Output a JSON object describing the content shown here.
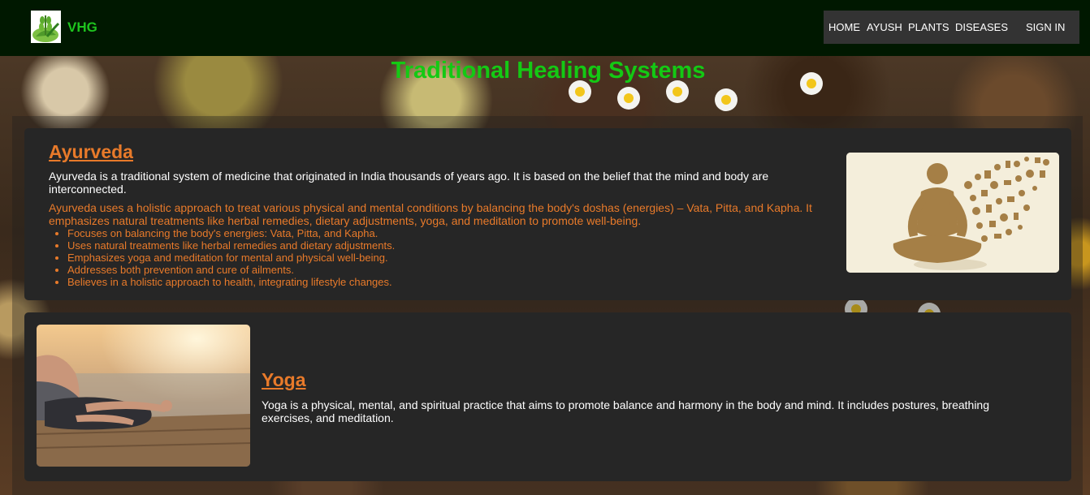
{
  "header": {
    "brand": "VHG",
    "nav": {
      "home": "HOME",
      "ayush": "AYUSH",
      "plants": "PLANTS",
      "diseases": "DISEASES",
      "sign_in": "SIGN IN"
    }
  },
  "page": {
    "title": "Traditional Healing Systems"
  },
  "ayurveda": {
    "title": "Ayurveda",
    "intro": "Ayurveda is a traditional system of medicine that originated in India thousands of years ago. It is based on the belief that the mind and body are interconnected.",
    "detail": "Ayurveda uses a holistic approach to treat various physical and mental conditions by balancing the body's doshas (energies) – Vata, Pitta, and Kapha. It emphasizes natural treatments like herbal remedies, dietary adjustments, yoga, and meditation to promote well-being.",
    "points": [
      "Focuses on balancing the body's energies: Vata, Pitta, and Kapha.",
      "Uses natural treatments like herbal remedies and dietary adjustments.",
      "Emphasizes yoga and meditation for mental and physical well-being.",
      "Addresses both prevention and cure of ailments.",
      "Believes in a holistic approach to health, integrating lifestyle changes."
    ]
  },
  "yoga": {
    "title": "Yoga",
    "intro": "Yoga is a physical, mental, and spiritual practice that aims to promote balance and harmony in the body and mind. It includes postures, breathing exercises, and meditation."
  },
  "colors": {
    "header_bg": "#001800",
    "brand_green": "#1ec41e",
    "title_green": "#14c914",
    "accent_orange": "#e87a2a",
    "card_bg": "#262626",
    "nav_bg": "#333333"
  },
  "icons": {
    "logo": "herbal-leaf-logo-icon",
    "ayurveda_image": "meditating-figure-with-medical-icons",
    "yoga_image": "person-meditating-lotus-pose-photo"
  }
}
